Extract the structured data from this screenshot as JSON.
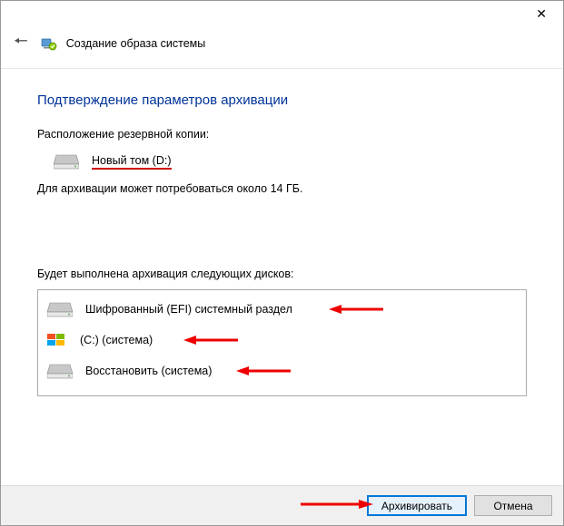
{
  "window": {
    "title": "Создание образа системы"
  },
  "heading": "Подтверждение параметров архивации",
  "backup_location_label": "Расположение резервной копии:",
  "destination": {
    "name": "Новый том (D:)"
  },
  "size_note": "Для архивации может потребоваться около 14 ГБ.",
  "disks_label": "Будет выполнена архивация следующих дисков:",
  "disks": [
    {
      "name": "Шифрованный (EFI) системный раздел",
      "icon": "drive"
    },
    {
      "name": "(C:) (система)",
      "icon": "windows"
    },
    {
      "name": "Восстановить (система)",
      "icon": "drive"
    }
  ],
  "buttons": {
    "archive": "Архивировать",
    "cancel": "Отмена"
  }
}
